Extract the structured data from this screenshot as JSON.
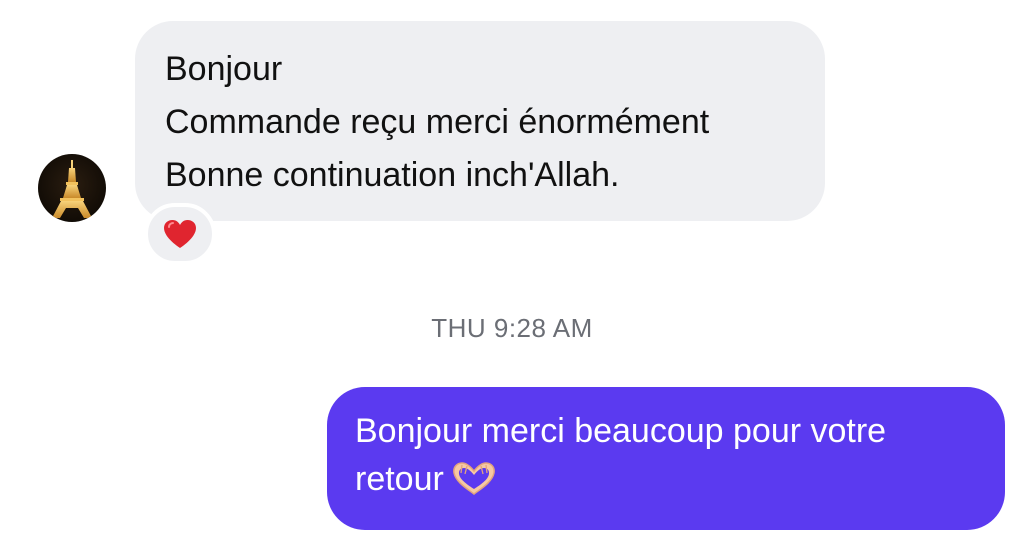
{
  "incoming_message": {
    "lines": [
      "Bonjour",
      "Commande reçu merci énormément",
      "Bonne continuation inch'Allah."
    ],
    "reaction_icon": "red-heart-emoji",
    "reaction_color": "#e0252f",
    "bubble_color": "#eeeff2"
  },
  "timestamp": "THU 9:28 AM",
  "outgoing_message": {
    "lines": [
      "Bonjour merci beaucoup pour votre",
      "retour"
    ],
    "emoji_icon": "heart-hands-emoji",
    "bubble_color": "#5b3af0"
  }
}
